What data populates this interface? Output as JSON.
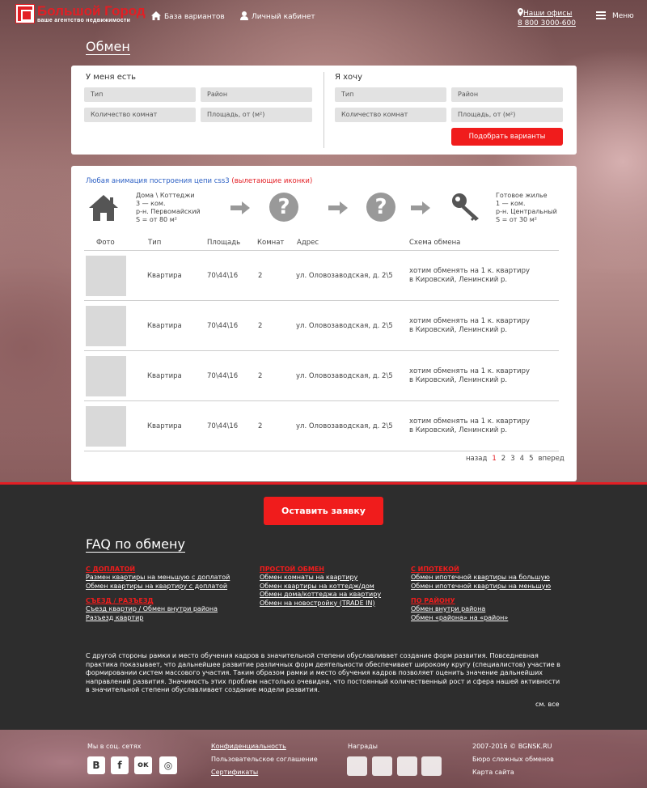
{
  "header": {
    "logo_title": "Большой Город",
    "logo_subtitle": "ваше агентство недвижимости",
    "nav": [
      {
        "label": "База вариантов",
        "icon": "home-icon"
      },
      {
        "label": "Личный кабинет",
        "icon": "user-icon"
      }
    ],
    "offices_label": "Наши офисы",
    "phone": "8 800 3000-600",
    "menu_label": "Меню"
  },
  "page_title": "Обмен",
  "filter": {
    "have_title": "У меня есть",
    "want_title": "Я хочу",
    "have_fields": [
      "Тип",
      "Район",
      "Количество комнат",
      "Площадь, от (м²)"
    ],
    "want_fields": [
      "Тип",
      "Район",
      "Количество комнат",
      "Площадь, от (м²)"
    ],
    "submit_label": "Подобрать варианты"
  },
  "chain": {
    "link_text": "Любая анимация построения цепи css3",
    "link_note": "(вылетающие иконки)",
    "have_lines": [
      "Дома \\ Коттеджи",
      "3 — ком.",
      "р-н. Первомайский",
      "S = от 80 м²"
    ],
    "want_lines": [
      "Готовое жилье",
      "1 — ком.",
      "р-н. Центральный",
      "S = от 30 м²"
    ]
  },
  "table": {
    "headers": [
      "Фото",
      "Тип",
      "Площадь",
      "Комнат",
      "Адрес",
      "Схема обмена"
    ],
    "rows": [
      {
        "type": "Квартира",
        "area": "70\\44\\16",
        "rooms": "2",
        "address": "ул. Оловозаводская, д. 2\\5",
        "scheme1": "хотим обменять на 1 к. квартиру",
        "scheme2": "в Кировский, Ленинский р."
      },
      {
        "type": "Квартира",
        "area": "70\\44\\16",
        "rooms": "2",
        "address": "ул. Оловозаводская, д. 2\\5",
        "scheme1": "хотим обменять на 1 к. квартиру",
        "scheme2": "в Кировский, Ленинский р."
      },
      {
        "type": "Квартира",
        "area": "70\\44\\16",
        "rooms": "2",
        "address": "ул. Оловозаводская, д. 2\\5",
        "scheme1": "хотим обменять на 1 к. квартиру",
        "scheme2": "в Кировский, Ленинский р."
      },
      {
        "type": "Квартира",
        "area": "70\\44\\16",
        "rooms": "2",
        "address": "ул. Оловозаводская, д. 2\\5",
        "scheme1": "хотим обменять на 1 к. квартиру",
        "scheme2": "в Кировский, Ленинский р."
      }
    ]
  },
  "pagination": {
    "prev": "назад",
    "pages": [
      "1",
      "2",
      "3",
      "4",
      "5"
    ],
    "current": "1",
    "next": "вперед"
  },
  "cta_label": "Оставить заявку",
  "faq": {
    "title": "FAQ по обмену",
    "columns": [
      [
        {
          "head": "С ДОПЛАТОЙ",
          "links": [
            "Размен квартиры на меньшую с доплатой",
            "Обмен квартиры на квартиру с доплатой"
          ]
        },
        {
          "head": "СЪЕЗД / РАЗЪЕЗД",
          "links": [
            "Съезд квартир / Обмен внутри района",
            "Разъезд квартир"
          ]
        }
      ],
      [
        {
          "head": "ПРОСТОЙ ОБМЕН",
          "links": [
            "Обмен комнаты на квартиру",
            "Обмен квартиры на коттедж/дом",
            "Обмен дома/коттеджа на квартиру",
            "Обмен на новостройку (TRADE IN)"
          ]
        }
      ],
      [
        {
          "head": "С ИПОТЕКОЙ",
          "links": [
            "Обмен ипотечной квартиры на большую",
            "Обмен ипотечной квартиры на меньшую"
          ]
        },
        {
          "head": "ПО РАЙОНУ",
          "links": [
            "Обмен внутри района",
            "Обмен «района» на «район»"
          ]
        }
      ]
    ],
    "seo_text": "С другой стороны рамки и место обучения кадров в значительной степени обуславливает создание форм развития. Повседневная практика показывает, что дальнейшее развитие различных форм деятельности обеспечивает широкому кругу (специалистов) участие в формировании систем массового участия. Таким образом рамки и место обучения кадров позволяет оценить значение дальнейших направлений развития. Значимость этих проблем настолько очевидна, что постоянный количественный рост и сфера нашей активности в значительной степени обуславливает создание модели развития.",
    "see_all": "см. все"
  },
  "footer": {
    "social_title": "Мы в соц. сетях",
    "social": [
      {
        "glyph": "В",
        "icon": "vk-icon"
      },
      {
        "glyph": "f",
        "icon": "facebook-icon"
      },
      {
        "glyph": "ок",
        "icon": "odnoklassniki-icon"
      },
      {
        "glyph": "◎",
        "icon": "instagram-icon"
      }
    ],
    "links": [
      "Конфиденциальность",
      "Пользовательское соглашение",
      "Сертификаты"
    ],
    "awards_title": "Награды",
    "copyright": "2007-2016 © BGNSK.RU",
    "bureau": "Бюро сложных обменов",
    "sitemap": "Карта сайта"
  }
}
